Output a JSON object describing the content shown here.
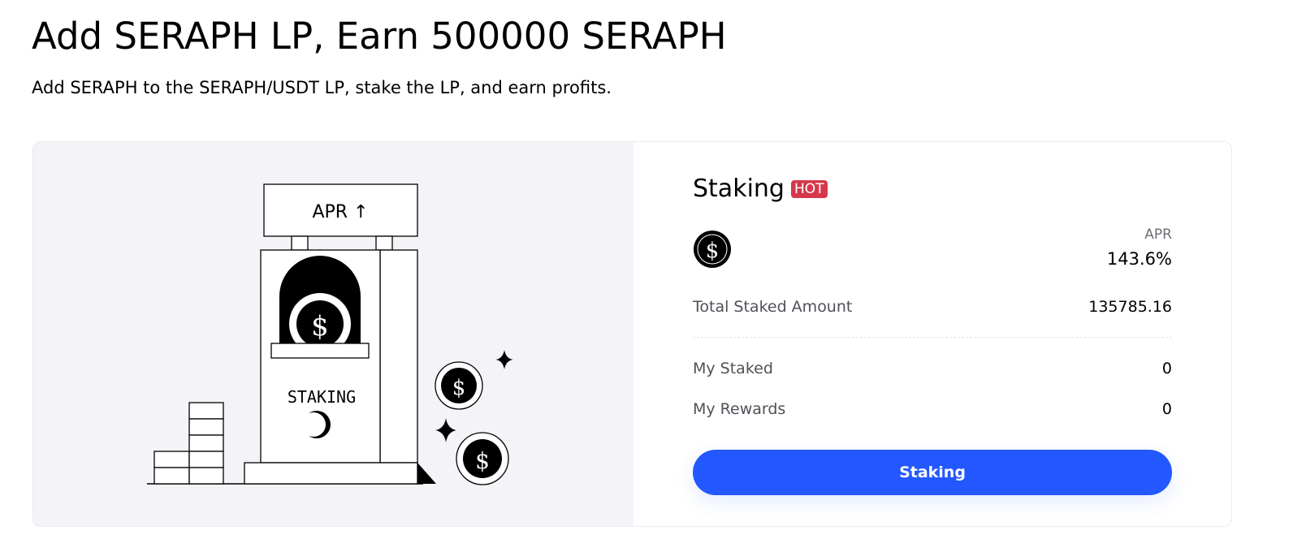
{
  "header": {
    "title": "Add SERAPH LP, Earn 500000 SERAPH",
    "subtitle": "Add SERAPH to the SERAPH/USDT LP, stake the LP, and earn profits."
  },
  "illustration": {
    "sign_text": "APR ↑",
    "machine_label": "STAKING",
    "coin_symbol": "$"
  },
  "staking_card": {
    "title": "Staking",
    "badge": "HOT",
    "token_icon": "seraph-token-icon",
    "apr_label": "APR",
    "apr_value": "143.6%",
    "total_staked_label": "Total Staked Amount",
    "total_staked_value": "135785.16",
    "my_staked_label": "My Staked",
    "my_staked_value": "0",
    "my_rewards_label": "My Rewards",
    "my_rewards_value": "0",
    "button_label": "Staking"
  },
  "colors": {
    "accent": "#2357ff",
    "hot_badge": "#d6384b",
    "illustration_bg": "#f4f4f8"
  }
}
